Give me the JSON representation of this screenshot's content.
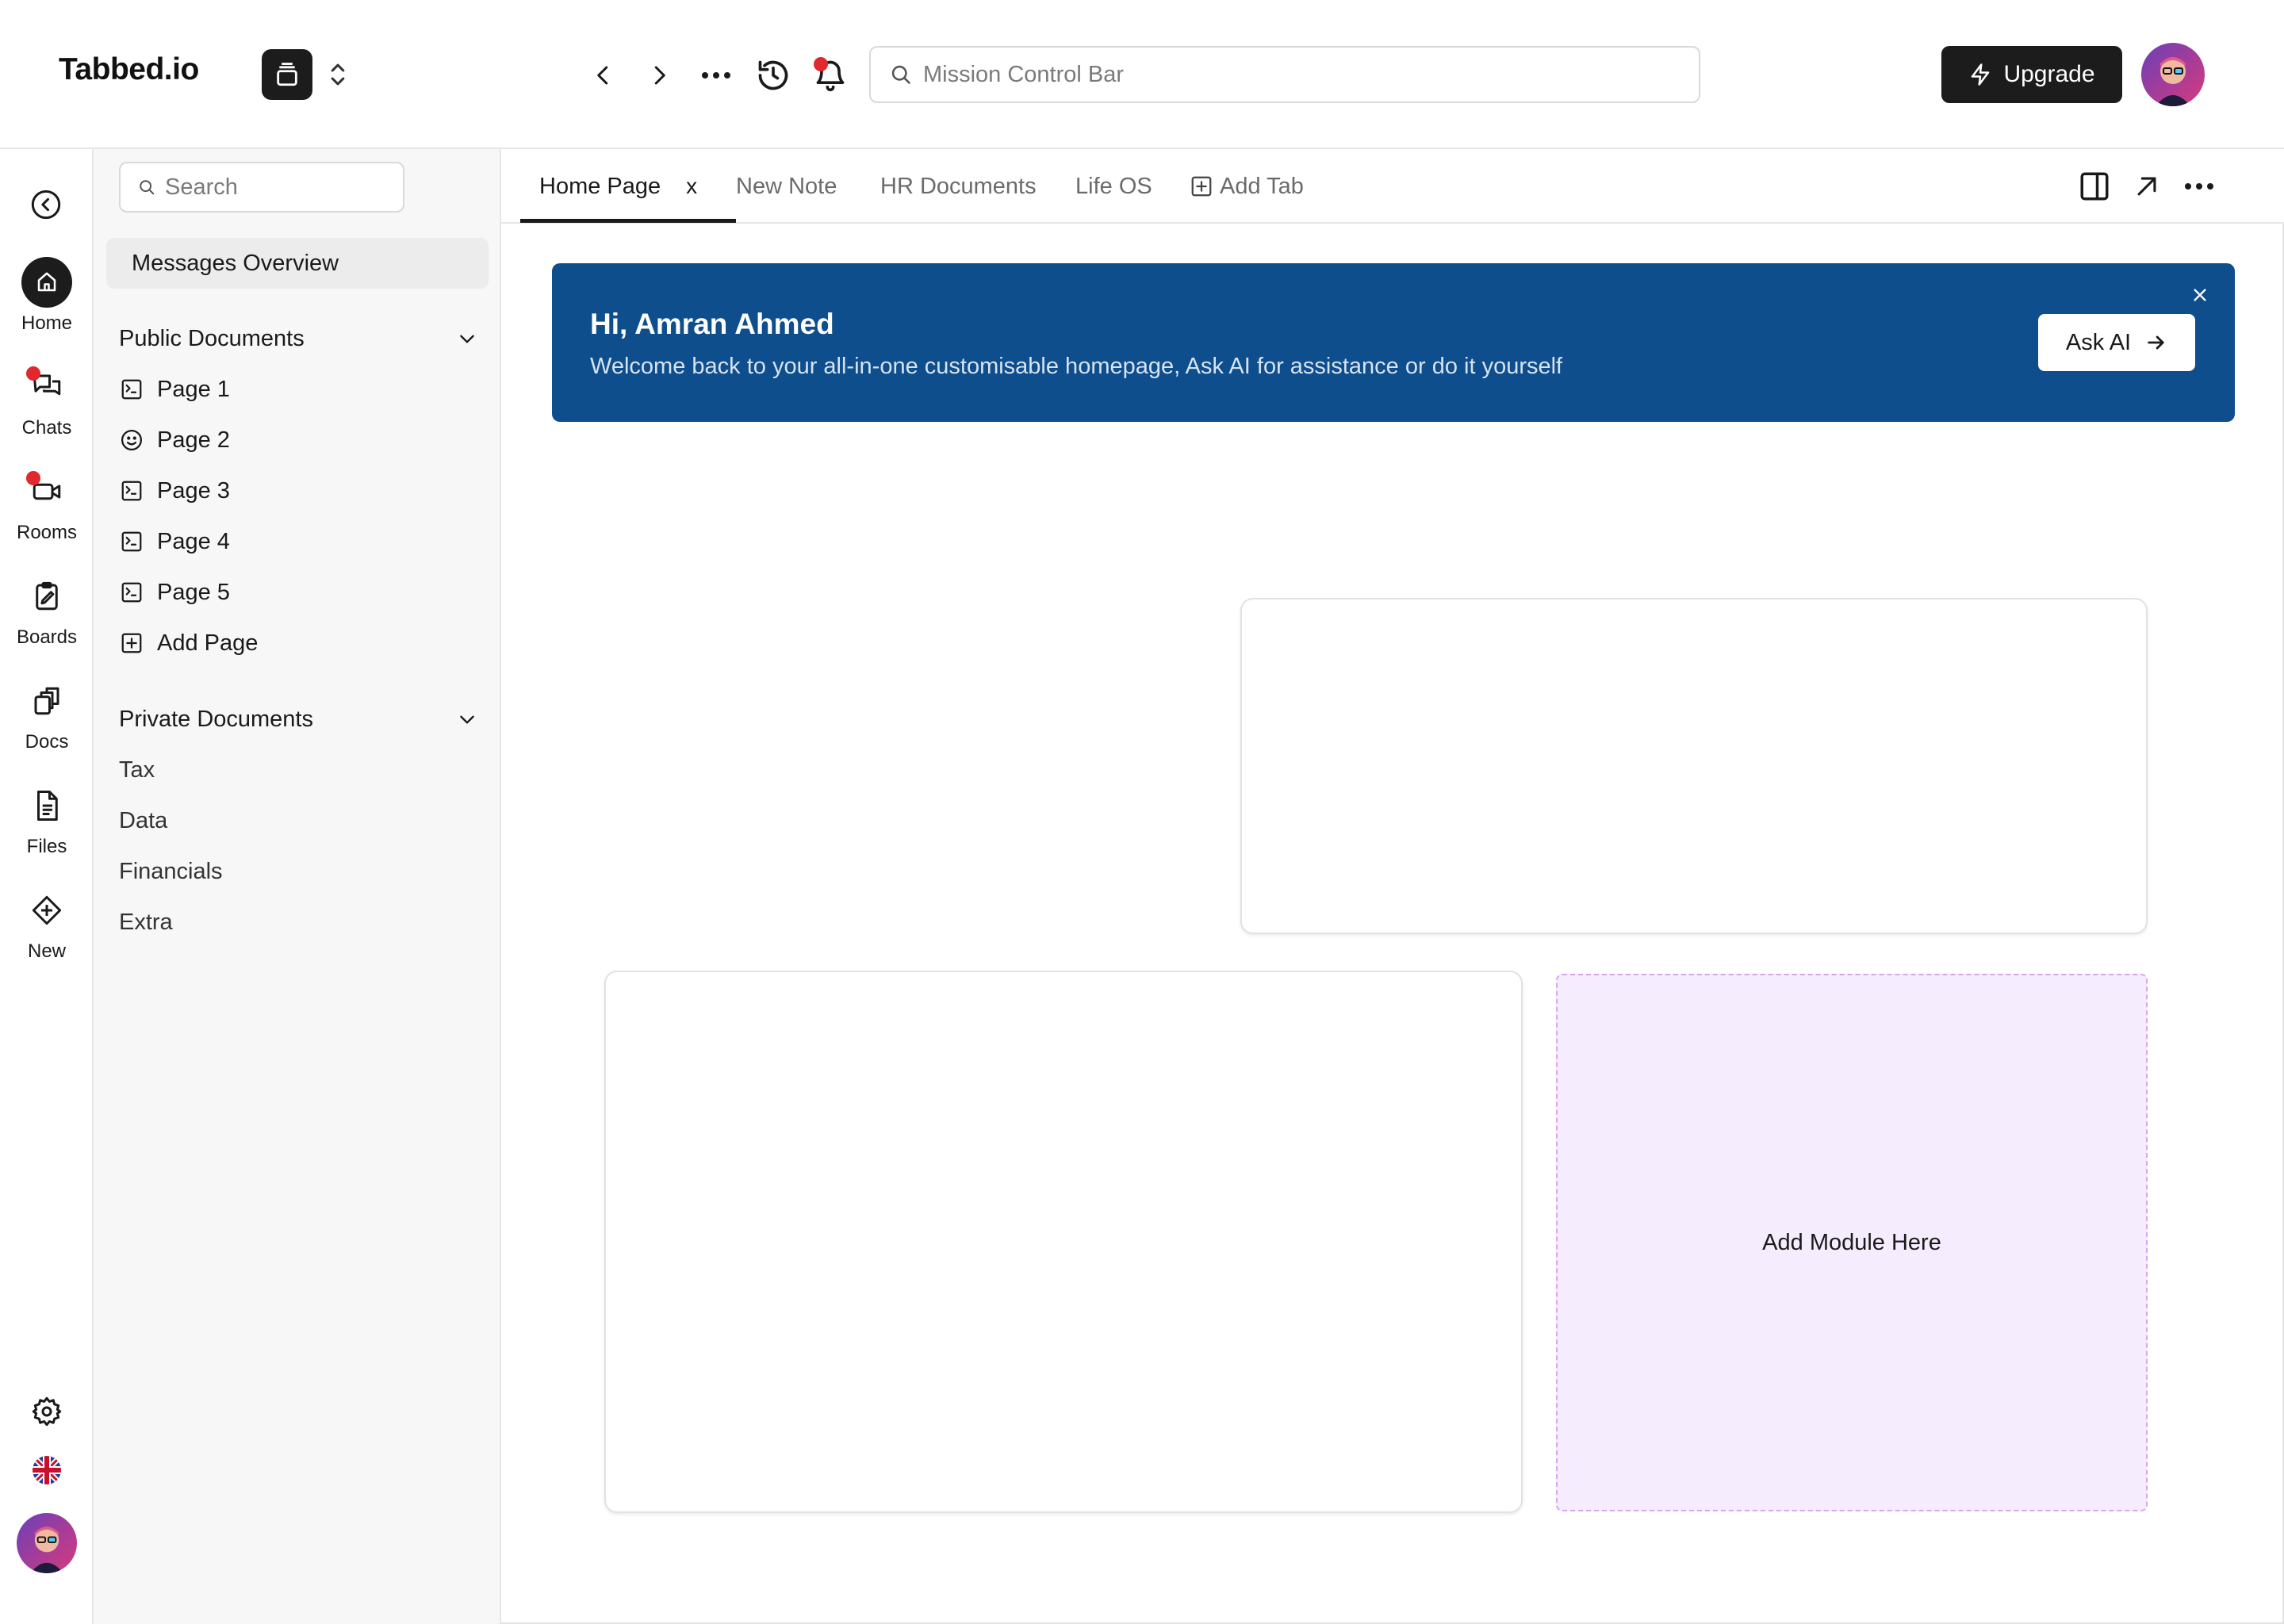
{
  "app": {
    "title": "Tabbed.io"
  },
  "topbar": {
    "search_placeholder": "Mission Control Bar",
    "upgrade_label": "Upgrade"
  },
  "rail": {
    "items": [
      {
        "label": "Home",
        "icon": "home-icon",
        "active": true
      },
      {
        "label": "Chats",
        "icon": "chats-icon",
        "badge": true
      },
      {
        "label": "Rooms",
        "icon": "video-icon",
        "badge": true
      },
      {
        "label": "Boards",
        "icon": "clipboard-icon"
      },
      {
        "label": "Docs",
        "icon": "docs-icon"
      },
      {
        "label": "Files",
        "icon": "file-icon"
      },
      {
        "label": "New",
        "icon": "plus-diamond-icon"
      }
    ]
  },
  "sidebar": {
    "search_placeholder": "Search",
    "messages_overview": "Messages Overview",
    "public_title": "Public Documents",
    "public_pages": [
      {
        "label": "Page 1",
        "icon": "terminal-icon"
      },
      {
        "label": "Page 2",
        "icon": "smiley-icon"
      },
      {
        "label": "Page 3",
        "icon": "terminal-icon"
      },
      {
        "label": "Page 4",
        "icon": "terminal-icon"
      },
      {
        "label": "Page 5",
        "icon": "terminal-icon"
      }
    ],
    "add_page": "Add Page",
    "private_title": "Private Documents",
    "private_items": [
      "Tax",
      "Data",
      "Financials",
      "Extra"
    ]
  },
  "tabs": {
    "items": [
      "Home Page",
      "New Note",
      "HR Documents",
      "Life OS"
    ],
    "close_label": "x",
    "add_tab": "Add Tab"
  },
  "banner": {
    "title": "Hi, Amran Ahmed",
    "subtitle": "Welcome back to your all-in-one customisable homepage, Ask AI for assistance or do it yourself",
    "ask_ai": "Ask AI",
    "color": "#0e4e8d"
  },
  "main": {
    "add_module": "Add Module Here"
  },
  "colors": {
    "accent_dark": "#1c1c1c",
    "notification": "#e0282e",
    "dropzone_bg": "#f5ecfd",
    "dropzone_border": "#d8a6ec"
  }
}
